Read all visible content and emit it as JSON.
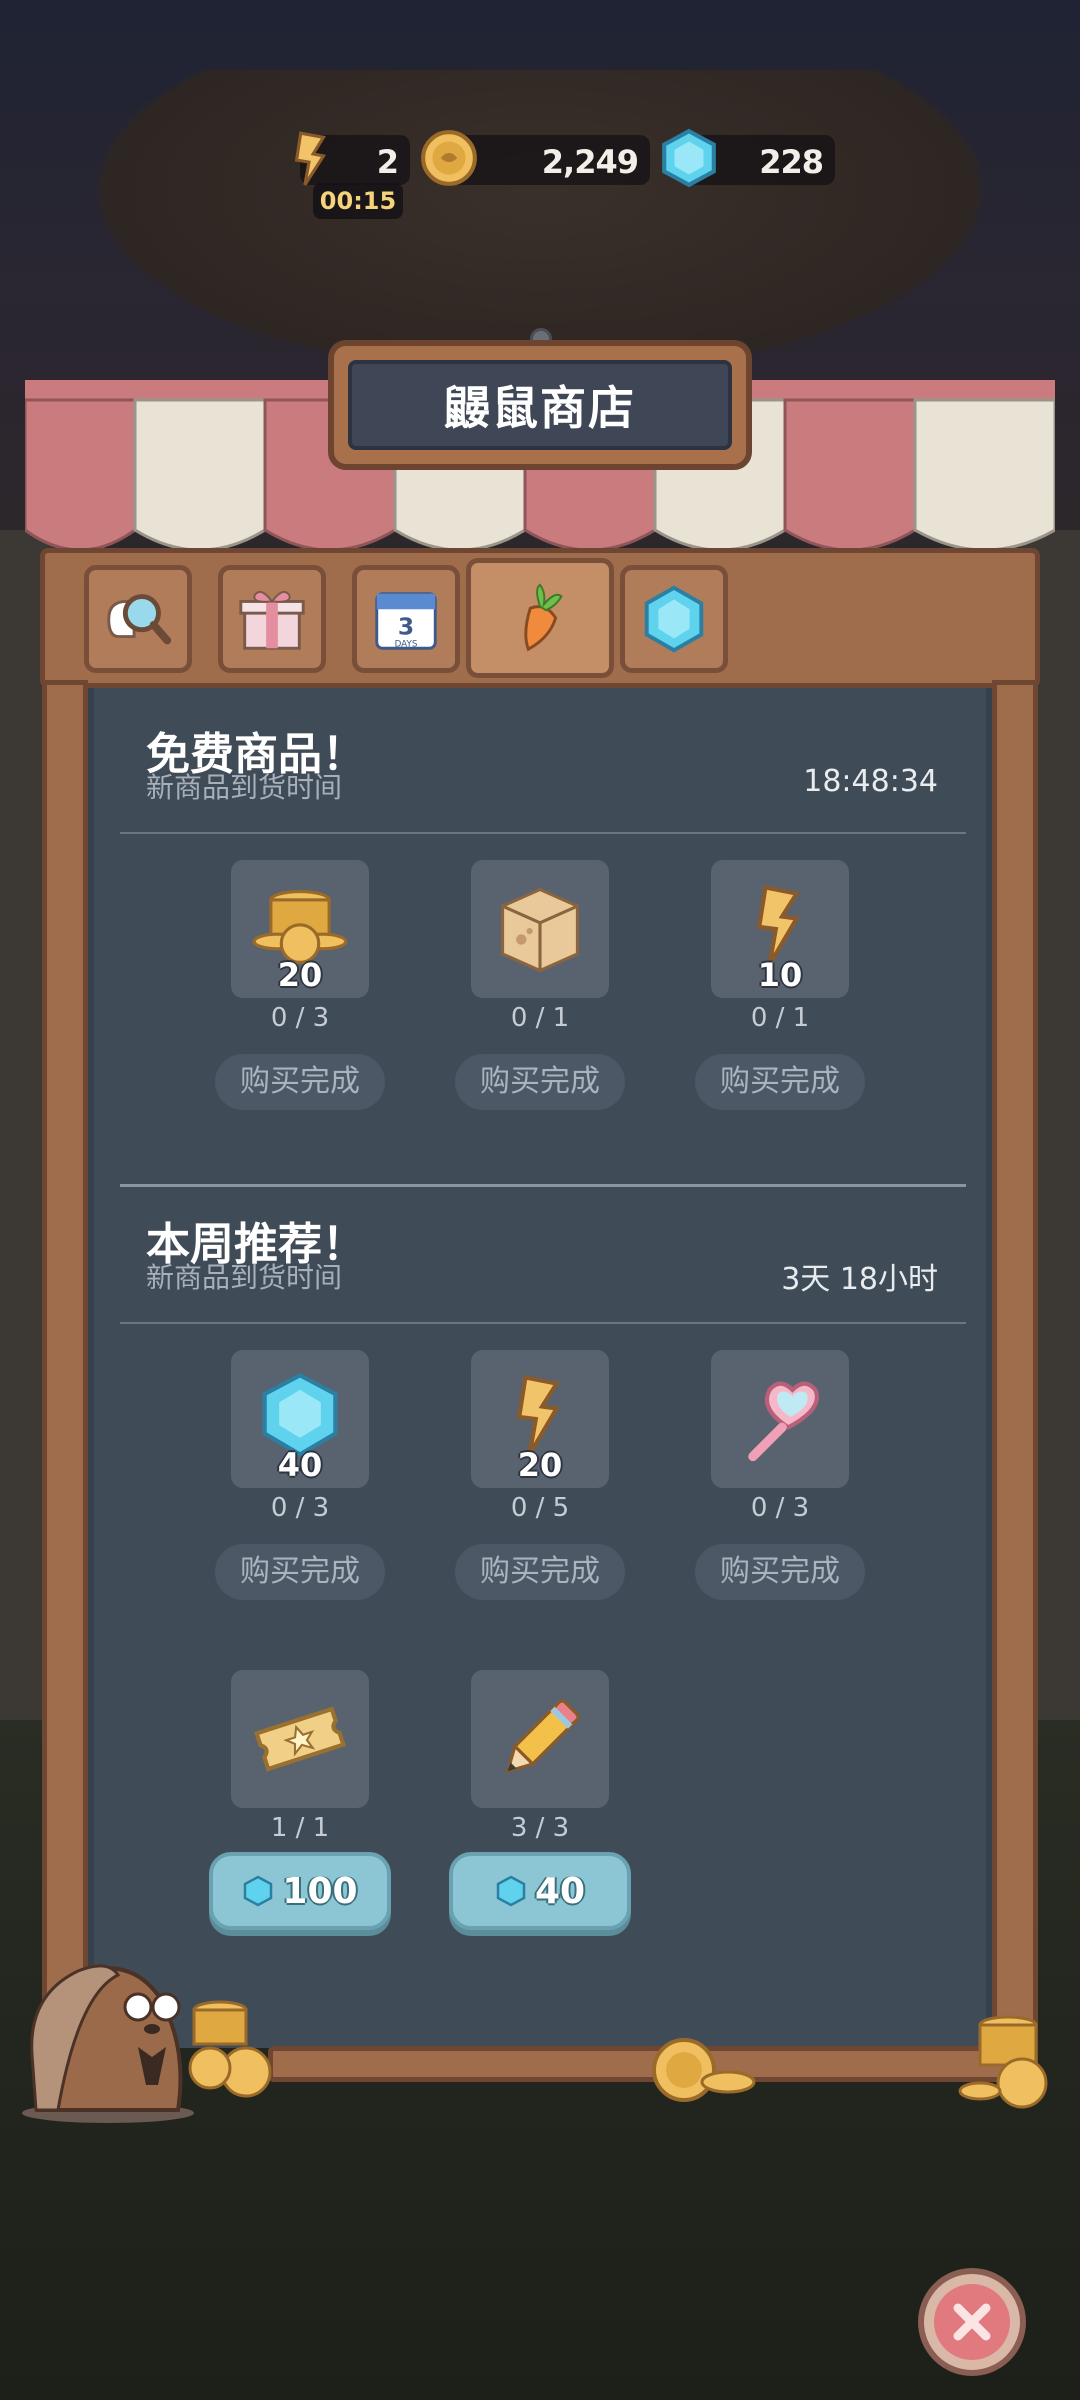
{
  "hud": {
    "energy": "2",
    "energy_timer": "00:15",
    "coins": "2,249",
    "gems": "228"
  },
  "shop": {
    "title": "鼹鼠商店",
    "tabs": [
      {
        "icon": "magnifier-icon"
      },
      {
        "icon": "gift-icon"
      },
      {
        "icon": "calendar-3-days-icon",
        "label": "3",
        "sublabel": "DAYS"
      },
      {
        "icon": "carrot-icon",
        "active": true
      },
      {
        "icon": "gem-icon"
      }
    ]
  },
  "free_section": {
    "title": "免费商品！",
    "subtitle": "新商品到货时间",
    "time": "18:48:34",
    "items": [
      {
        "icon": "coin-stack-icon",
        "qty": "20",
        "count": "0 / 3",
        "button": "购买完成"
      },
      {
        "icon": "mystery-box-icon",
        "qty": "",
        "count": "0 / 1",
        "button": "购买完成"
      },
      {
        "icon": "energy-bolt-icon",
        "qty": "10",
        "count": "0 / 1",
        "button": "购买完成"
      }
    ]
  },
  "weekly_section": {
    "title": "本周推荐！",
    "subtitle": "新商品到货时间",
    "time": "3天 18小时",
    "items": [
      {
        "icon": "gem-icon",
        "qty": "40",
        "count": "0 / 3",
        "button": "购买完成"
      },
      {
        "icon": "energy-bolt-icon",
        "qty": "20",
        "count": "0 / 5",
        "button": "购买完成"
      },
      {
        "icon": "heart-mirror-icon",
        "qty": "",
        "count": "0 / 3",
        "button": "购买完成"
      },
      {
        "icon": "star-ticket-icon",
        "qty": "",
        "count": "1 / 1",
        "price": "100"
      },
      {
        "icon": "pencil-icon",
        "qty": "",
        "count": "3 / 3",
        "price": "40"
      }
    ]
  },
  "colors": {
    "panel": "#404b58",
    "wood": "#a06d4c",
    "price_button": "#8cc6d4",
    "close_button": "#e07a7f"
  }
}
